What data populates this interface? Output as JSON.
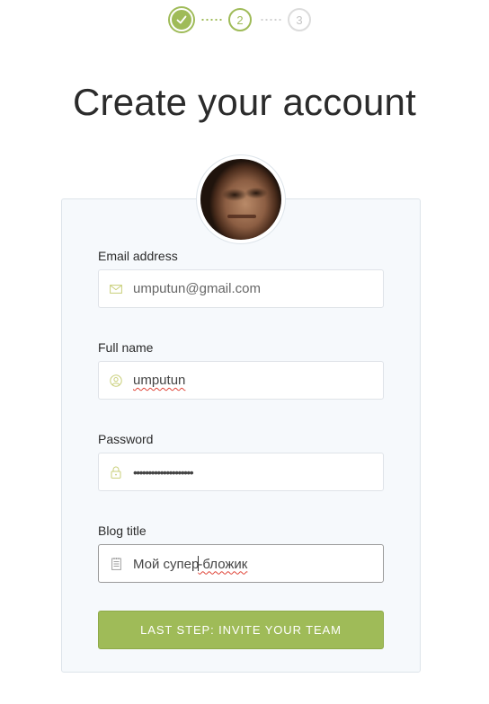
{
  "progress": {
    "steps": [
      {
        "label": "",
        "status": "completed",
        "icon": "checkmark-icon"
      },
      {
        "label": "2",
        "status": "current"
      },
      {
        "label": "3",
        "status": "upcoming"
      }
    ]
  },
  "title": "Create your account",
  "form": {
    "email": {
      "label": "Email address",
      "value": "umputun@gmail.com",
      "icon": "envelope-icon"
    },
    "full_name": {
      "label": "Full name",
      "value": "umputun",
      "icon": "user-icon"
    },
    "password": {
      "label": "Password",
      "value": "••••••••••••••••••••",
      "icon": "lock-icon"
    },
    "blog_title": {
      "label": "Blog title",
      "value_before_caret": "Мой супер",
      "value_after_caret": "-бложик",
      "icon": "notepad-icon"
    },
    "submit_label": "LAST STEP: INVITE YOUR TEAM"
  },
  "colors": {
    "accent": "#9fbb58",
    "card_background": "#f6f9fc",
    "inactive_step": "#dcdcdc"
  }
}
